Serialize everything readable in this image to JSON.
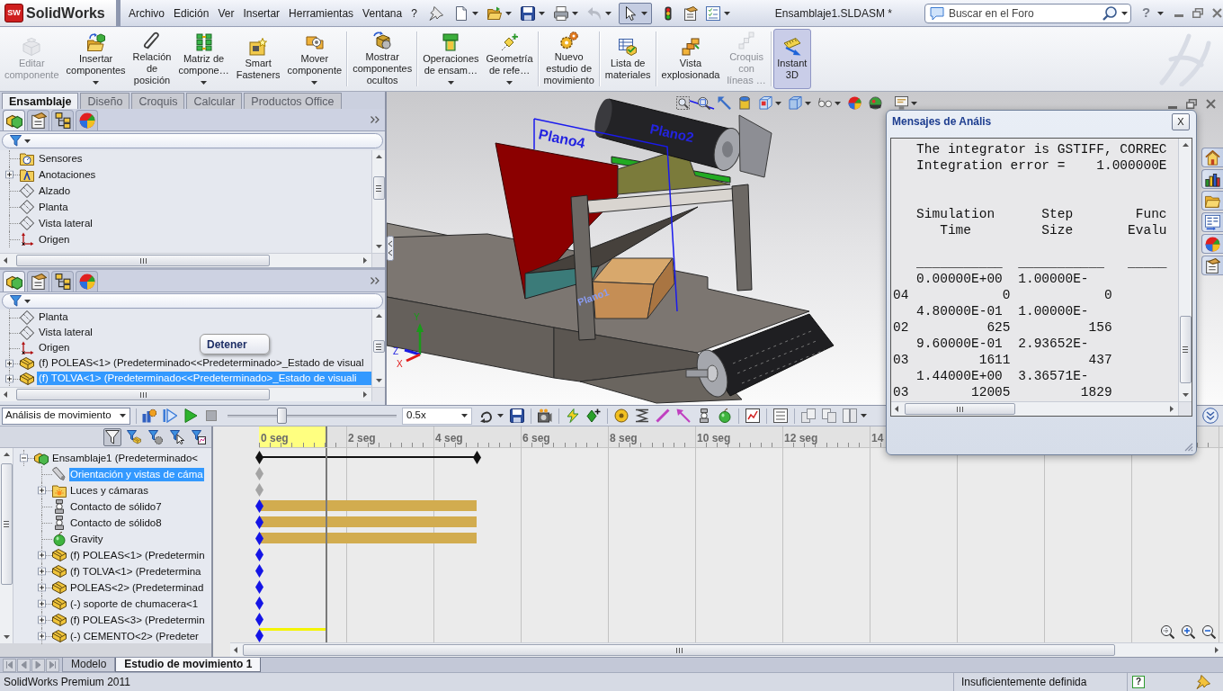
{
  "titlebar": {
    "logo_mark": "SW",
    "logo_name": "SolidWorks",
    "menu": [
      "Archivo",
      "Edición",
      "Ver",
      "Insertar",
      "Herramientas",
      "Ventana",
      "?"
    ],
    "select_tool": {
      "on": true
    },
    "document_title": "Ensamblaje1.SLDASM *",
    "search": {
      "placeholder": "Buscar en el Foro"
    },
    "help": "?"
  },
  "ribbon": {
    "groups": [
      {
        "buttons": [
          {
            "label": "Editar\ncomponente",
            "disabled": true,
            "dropdown": false,
            "active": false
          },
          {
            "label": "Insertar\ncomponentes",
            "disabled": false,
            "dropdown": true,
            "active": false
          },
          {
            "label": "Relación\nde\nposición",
            "disabled": false,
            "dropdown": false,
            "active": false
          },
          {
            "label": "Matriz de\ncompone…",
            "disabled": false,
            "dropdown": true,
            "active": false
          },
          {
            "label": "Smart\nFasteners",
            "disabled": false,
            "dropdown": false,
            "active": false
          },
          {
            "label": "Mover\ncomponente",
            "disabled": false,
            "dropdown": true,
            "active": false
          }
        ]
      },
      {
        "buttons": [
          {
            "label": "Mostrar\ncomponentes\nocultos",
            "disabled": false,
            "dropdown": false,
            "active": false
          }
        ]
      },
      {
        "buttons": [
          {
            "label": "Operaciones\nde ensam…",
            "disabled": false,
            "dropdown": true,
            "active": false
          },
          {
            "label": "Geometría\nde refe…",
            "disabled": false,
            "dropdown": true,
            "active": false
          }
        ]
      },
      {
        "buttons": [
          {
            "label": "Nuevo\nestudio de\nmovimiento",
            "disabled": false,
            "dropdown": false,
            "active": false
          }
        ]
      },
      {
        "buttons": [
          {
            "label": "Lista de\nmateriales",
            "disabled": false,
            "dropdown": false,
            "active": false
          }
        ]
      },
      {
        "buttons": [
          {
            "label": "Vista\nexplosionada",
            "disabled": false,
            "dropdown": false,
            "active": false
          },
          {
            "label": "Croquis\ncon\nlíneas …",
            "disabled": true,
            "dropdown": false,
            "active": false
          }
        ]
      },
      {
        "buttons": [
          {
            "label": "Instant\n3D",
            "disabled": false,
            "dropdown": false,
            "active": true
          }
        ]
      }
    ]
  },
  "tabs": [
    {
      "label": "Ensamblaje",
      "selected": true
    },
    {
      "label": "Diseño",
      "selected": false
    },
    {
      "label": "Croquis",
      "selected": false
    },
    {
      "label": "Calcular",
      "selected": false
    },
    {
      "label": "Productos Office",
      "selected": false
    }
  ],
  "feature_panes": [
    {
      "icon_tabs": [
        {
          "kind": "feature-tree",
          "selected": true
        },
        {
          "kind": "properties",
          "selected": false
        },
        {
          "kind": "configurations",
          "selected": false
        },
        {
          "kind": "appearance",
          "selected": false
        }
      ],
      "tree": [
        {
          "label": "Sensores",
          "kind": "sensors",
          "expandable": false,
          "expanded": false,
          "selected": false
        },
        {
          "label": "Anotaciones",
          "kind": "annotations",
          "expandable": true,
          "expanded": false,
          "selected": false
        },
        {
          "label": "Alzado",
          "kind": "plane",
          "expandable": false,
          "expanded": false,
          "selected": false
        },
        {
          "label": "Planta",
          "kind": "plane",
          "expandable": false,
          "expanded": false,
          "selected": false
        },
        {
          "label": "Vista lateral",
          "kind": "plane",
          "expandable": false,
          "expanded": false,
          "selected": false
        },
        {
          "label": "Origen",
          "kind": "origin",
          "expandable": false,
          "expanded": false,
          "selected": false
        }
      ]
    },
    {
      "icon_tabs": [
        {
          "kind": "feature-tree",
          "selected": true
        },
        {
          "kind": "properties",
          "selected": false
        },
        {
          "kind": "configurations",
          "selected": false
        },
        {
          "kind": "appearance",
          "selected": false
        }
      ],
      "tree": [
        {
          "label": "Planta",
          "kind": "plane",
          "expandable": false,
          "expanded": false,
          "selected": false
        },
        {
          "label": "Vista lateral",
          "kind": "plane",
          "expandable": false,
          "expanded": false,
          "selected": false
        },
        {
          "label": "Origen",
          "kind": "origin",
          "expandable": false,
          "expanded": false,
          "selected": false
        },
        {
          "label": "(f) POLEAS<1> (Predeterminado<<Predeterminado>_Estado de visual",
          "kind": "part",
          "expandable": true,
          "expanded": false,
          "selected": false
        },
        {
          "label": "(f) TOLVA<1> (Predeterminado<<Predeterminado>_Estado de visuali",
          "kind": "part",
          "expandable": true,
          "expanded": false,
          "selected": true
        }
      ]
    }
  ],
  "tooltip": "Detener",
  "viewport": {
    "plane_labels": [
      "Plano4",
      "Plano2",
      "Plano1"
    ],
    "axes": [
      "Y",
      "Z",
      "X"
    ]
  },
  "analysis_dialog": {
    "title": "Mensajes de Anális",
    "close": "X",
    "log": "   The integrator is GSTIFF, CORREC\n   Integration error =    1.000000E\n\n\n   Simulation      Step        Func\n      Time         Size       Evalu\n\n   ___________  ___________   _____\n   0.00000E+00  1.00000E-\n04            0            0\n   4.80000E-01  1.00000E-\n02          625          156\n   9.60000E-01  2.93652E-\n03         1611          437\n   1.44000E+00  3.36571E-\n03        12005         1829"
  },
  "motion": {
    "study_type": "Análisis de movimiento",
    "playback": {
      "level": 0.31
    },
    "speed": "0.5x",
    "filters": [
      {
        "on": true
      },
      {
        "on": false
      },
      {
        "on": false
      },
      {
        "on": false
      },
      {
        "on": false
      }
    ],
    "ruler": [
      "0 seg",
      "2 seg",
      "4 seg",
      "6 seg",
      "8 seg",
      "10 seg",
      "12 seg",
      "14"
    ],
    "playhead": {
      "level": 0.069
    },
    "tree": [
      {
        "label": "Ensamblaje1 (Predeterminado<",
        "kind": "assembly",
        "expandable": true,
        "expanded": true,
        "selected": false,
        "track": {
          "kind": "summary",
          "level": 0.226
        },
        "children": [
          {
            "label": "Orientación y vistas de cáma",
            "kind": "view",
            "expandable": false,
            "expanded": false,
            "selected": true,
            "track": {
              "kind": "ghost"
            }
          },
          {
            "label": "Luces y cámaras",
            "kind": "lights",
            "expandable": true,
            "expanded": false,
            "selected": false,
            "track": {
              "kind": "ghost"
            }
          },
          {
            "label": "Contacto de sólido7",
            "kind": "contact",
            "expandable": false,
            "expanded": false,
            "selected": false,
            "track": {
              "kind": "bar",
              "level": 0.226
            }
          },
          {
            "label": "Contacto de sólido8",
            "kind": "contact",
            "expandable": false,
            "expanded": false,
            "selected": false,
            "track": {
              "kind": "bar",
              "level": 0.226
            }
          },
          {
            "label": "Gravity",
            "kind": "gravity",
            "expandable": false,
            "expanded": false,
            "selected": false,
            "track": {
              "kind": "bar",
              "level": 0.226
            }
          },
          {
            "label": "(f) POLEAS<1> (Predetermin",
            "kind": "part",
            "expandable": true,
            "expanded": false,
            "selected": false,
            "track": {
              "kind": "key"
            }
          },
          {
            "label": "(f) TOLVA<1> (Predetermina",
            "kind": "part",
            "expandable": true,
            "expanded": false,
            "selected": false,
            "track": {
              "kind": "key"
            }
          },
          {
            "label": "POLEAS<2> (Predeterminad",
            "kind": "part",
            "expandable": true,
            "expanded": false,
            "selected": false,
            "track": {
              "kind": "key"
            }
          },
          {
            "label": "(-) soporte de chumacera<1",
            "kind": "part",
            "expandable": true,
            "expanded": false,
            "selected": false,
            "track": {
              "kind": "key"
            }
          },
          {
            "label": "(f) POLEAS<3> (Predetermin",
            "kind": "part",
            "expandable": true,
            "expanded": false,
            "selected": false,
            "track": {
              "kind": "key"
            }
          },
          {
            "label": "(-) CEMENTO<2> (Predeter",
            "kind": "part",
            "expandable": true,
            "expanded": false,
            "selected": false,
            "track": {
              "kind": "progress",
              "level": 0.069
            }
          }
        ]
      }
    ]
  },
  "bottom_tabs": [
    {
      "label": "Modelo",
      "selected": false
    },
    {
      "label": "Estudio de movimiento 1",
      "selected": true
    }
  ],
  "status_bar": {
    "product": "SolidWorks Premium 2011",
    "state": "Insuficientemente definida",
    "help": "?"
  }
}
